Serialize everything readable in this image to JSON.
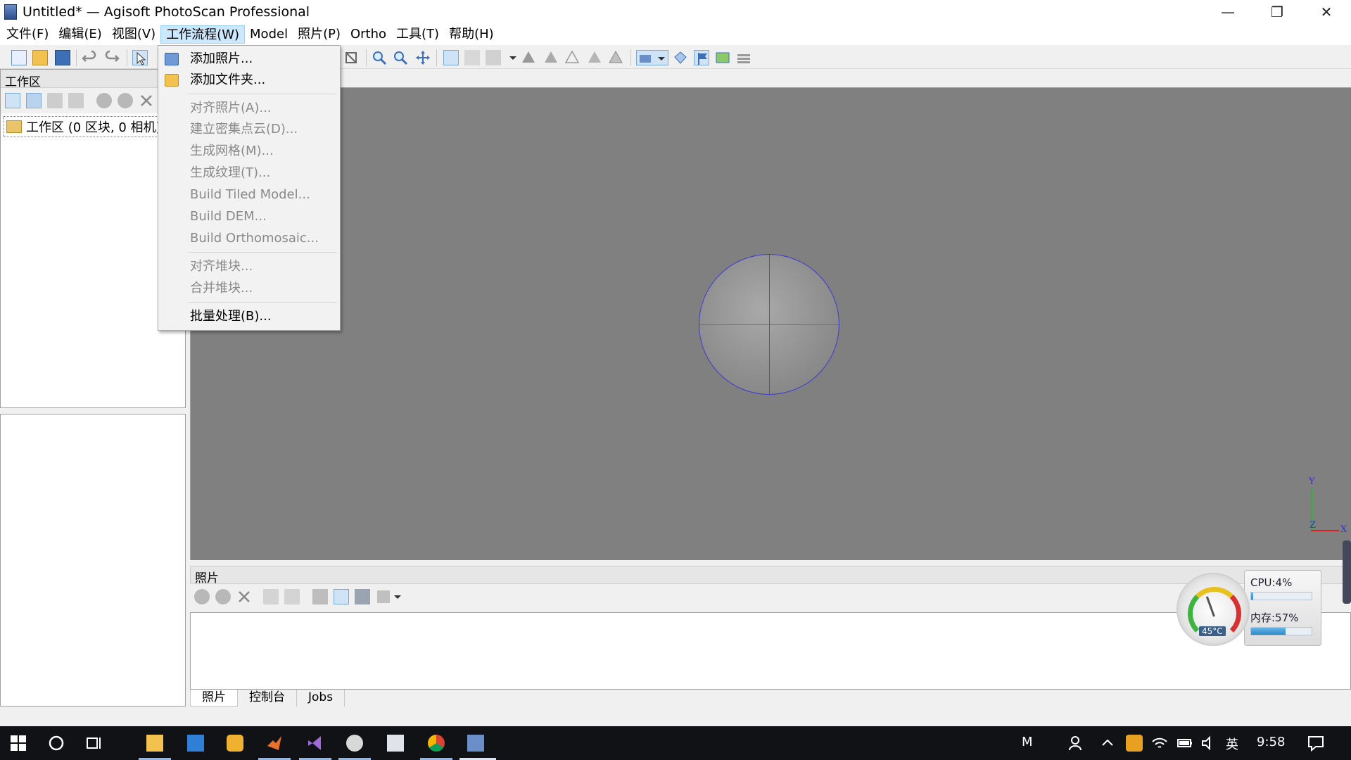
{
  "window": {
    "title": "Untitled* — Agisoft PhotoScan Professional"
  },
  "menubar": [
    "文件(F)",
    "编辑(E)",
    "视图(V)",
    "工作流程(W)",
    "Model",
    "照片(P)",
    "Ortho",
    "工具(T)",
    "帮助(H)"
  ],
  "active_menu_index": 3,
  "workflow_menu": {
    "items": [
      {
        "label": "添加照片...",
        "enabled": true,
        "icon": "add-photo-icon"
      },
      {
        "label": "添加文件夹...",
        "enabled": true,
        "icon": "add-folder-icon"
      },
      {
        "label": "对齐照片(A)...",
        "enabled": false
      },
      {
        "label": "建立密集点云(D)...",
        "enabled": false
      },
      {
        "label": "生成网格(M)...",
        "enabled": false
      },
      {
        "label": "生成纹理(T)...",
        "enabled": false
      },
      {
        "label": "Build Tiled Model...",
        "enabled": false
      },
      {
        "label": "Build DEM...",
        "enabled": false
      },
      {
        "label": "Build Orthomosaic...",
        "enabled": false
      },
      {
        "label": "对齐堆块...",
        "enabled": false
      },
      {
        "label": "合并堆块...",
        "enabled": false
      },
      {
        "label": "批量处理(B)...",
        "enabled": true
      }
    ]
  },
  "workspace": {
    "title": "工作区",
    "root_item": "工作区 (0 区块, 0 相机)"
  },
  "viewport": {
    "axis_labels": {
      "x": "X",
      "y": "Y",
      "z": "Z"
    }
  },
  "photos_panel": {
    "title": "照片",
    "tabs": [
      "照片",
      "控制台",
      "Jobs"
    ],
    "active_tab": 0
  },
  "system_monitor": {
    "cpu_label": "CPU:4%",
    "cpu_percent": 4,
    "mem_label": "内存:57%",
    "mem_percent": 57,
    "temperature": "45°C"
  },
  "taskbar": {
    "ime": "英",
    "clock": "9:58",
    "input_mode": "M"
  },
  "colors": {
    "viewport_bg": "#808080",
    "menu_highlight": "#cce8ff",
    "taskbar_bg": "#101216"
  }
}
